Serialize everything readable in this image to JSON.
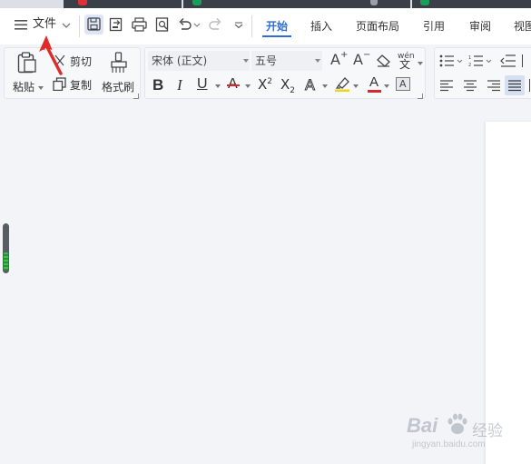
{
  "menu": {
    "file_label": "文件",
    "tabs": [
      "开始",
      "插入",
      "页面布局",
      "引用",
      "审阅",
      "视图"
    ],
    "active_tab": "开始"
  },
  "clipboard": {
    "paste_label": "粘贴",
    "cut_label": "剪切",
    "copy_label": "复制",
    "format_painter_label": "格式刷"
  },
  "font": {
    "family": "宋体 (正文)",
    "size": "五号",
    "phonetic_glyph": "wén"
  },
  "watermark": {
    "brand": "Bai",
    "brand_suffix": "经验",
    "url": "jingyan.baidu.com"
  },
  "colors": {
    "accent": "#2b6fd6",
    "annotation_arrow": "#e02b2b",
    "font_color_bar": "#d8262f",
    "highlight_bar": "#f2d21b"
  }
}
